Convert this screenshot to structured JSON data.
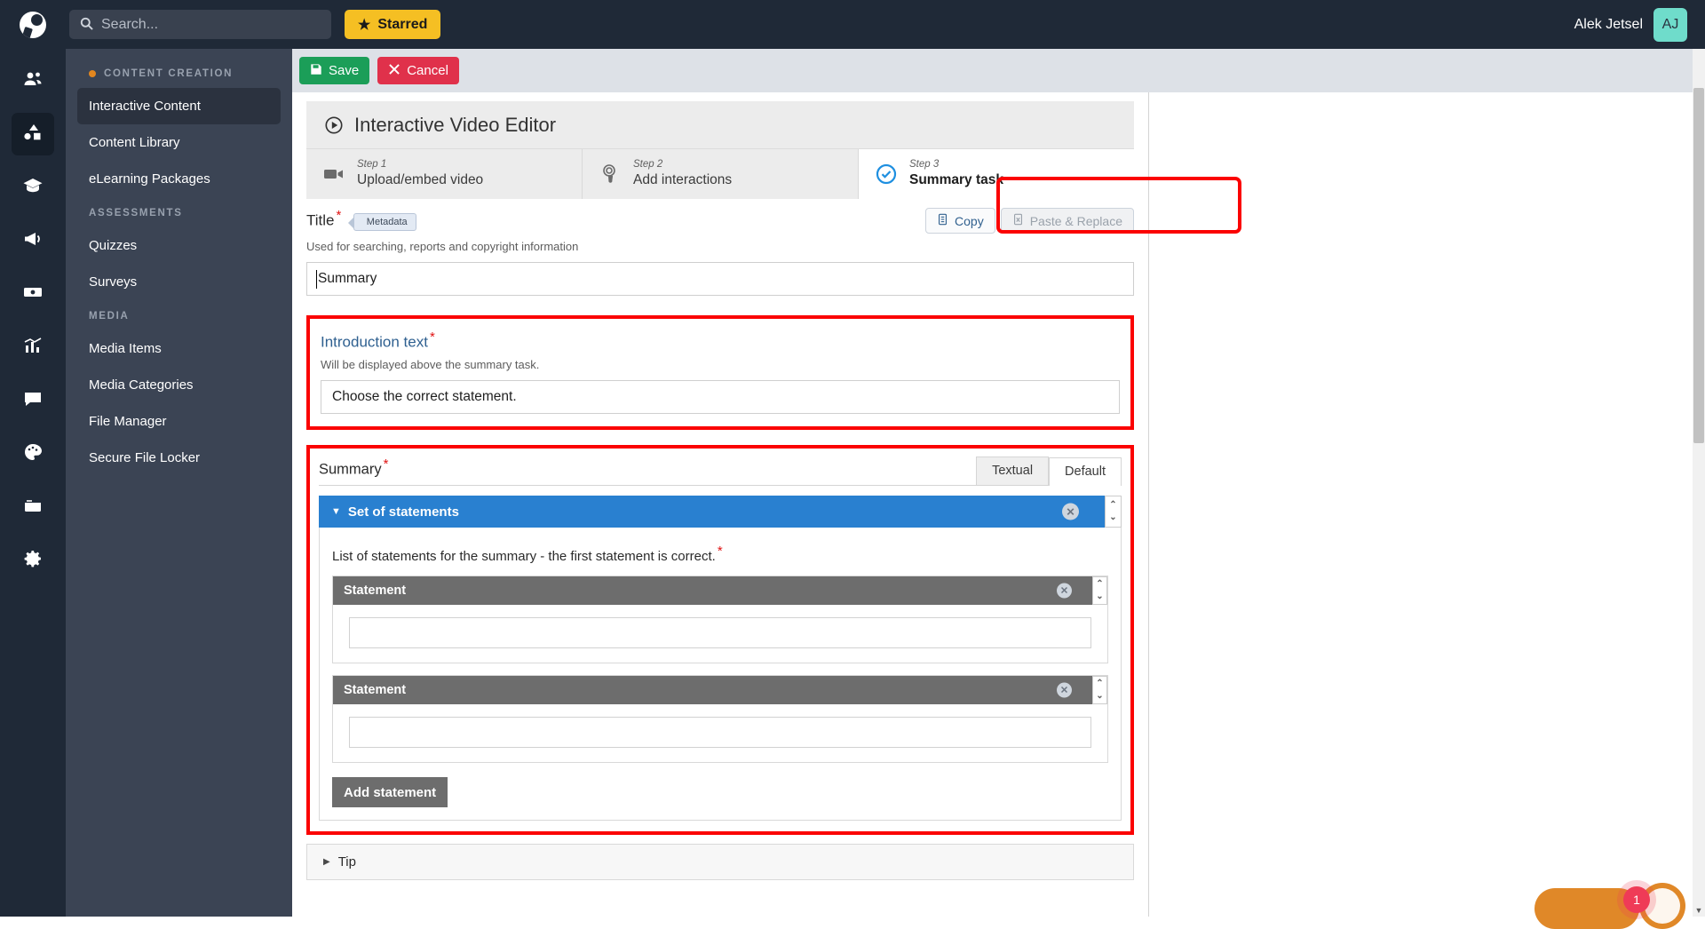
{
  "topbar": {
    "logo_icon": "app-logo-icon",
    "search": {
      "placeholder": "Search...",
      "icon": "search-icon"
    },
    "starred_label": "Starred",
    "starred_icon": "star-icon",
    "user_name": "Alek Jetsel",
    "avatar_initials": "AJ",
    "accent_yellow": "#f5bf23",
    "avatar_color": "#6fdccb"
  },
  "rail": {
    "items": [
      {
        "icon": "users-icon",
        "active": false
      },
      {
        "icon": "shapes-icon",
        "active": true
      },
      {
        "icon": "graduation-cap-icon",
        "active": false
      },
      {
        "icon": "megaphone-icon",
        "active": false
      },
      {
        "icon": "banknote-icon",
        "active": false
      },
      {
        "icon": "bar-chart-icon",
        "active": false
      },
      {
        "icon": "chat-bubble-icon",
        "active": false
      },
      {
        "icon": "palette-icon",
        "active": false
      },
      {
        "icon": "window-icon",
        "active": false
      },
      {
        "icon": "gear-icon",
        "active": false
      }
    ]
  },
  "sidebar": {
    "groups": [
      {
        "title": "CONTENT CREATION",
        "has_dot": true,
        "items": [
          {
            "label": "Interactive Content",
            "active": true
          },
          {
            "label": "Content Library",
            "active": false
          },
          {
            "label": "eLearning Packages",
            "active": false
          }
        ]
      },
      {
        "title": "ASSESSMENTS",
        "has_dot": false,
        "items": [
          {
            "label": "Quizzes",
            "active": false
          },
          {
            "label": "Surveys",
            "active": false
          }
        ]
      },
      {
        "title": "MEDIA",
        "has_dot": false,
        "items": [
          {
            "label": "Media Items",
            "active": false
          },
          {
            "label": "Media Categories",
            "active": false
          },
          {
            "label": "File Manager",
            "active": false
          },
          {
            "label": "Secure File Locker",
            "active": false
          }
        ]
      }
    ]
  },
  "toolbar": {
    "save_label": "Save",
    "save_icon": "floppy-disk-icon",
    "save_color": "#1b9e58",
    "cancel_label": "Cancel",
    "cancel_icon": "x-icon",
    "cancel_color": "#e0314b"
  },
  "editor": {
    "title": "Interactive Video Editor",
    "title_icon": "play-circle-icon",
    "steps": [
      {
        "step_label": "Step 1",
        "title": "Upload/embed video",
        "icon": "video-camera-icon",
        "active": false
      },
      {
        "step_label": "Step 2",
        "title": "Add interactions",
        "icon": "cursor-click-icon",
        "active": false
      },
      {
        "step_label": "Step 3",
        "title": "Summary task",
        "icon": "check-circle-icon",
        "active": true
      }
    ],
    "highlight_color": "#fb0202"
  },
  "title_field": {
    "label": "Title",
    "required_marker": "*",
    "metadata_tag": "Metadata",
    "help": "Used for searching, reports and copyright information",
    "value": "Summary",
    "copy_label": "Copy",
    "copy_icon": "clipboard-copy-icon",
    "paste_label": "Paste & Replace",
    "paste_icon": "clipboard-paste-icon"
  },
  "intro_field": {
    "label": "Introduction text",
    "required_marker": "*",
    "help": "Will be displayed above the summary task.",
    "value": "Choose the correct statement."
  },
  "summary_field": {
    "label": "Summary",
    "required_marker": "*",
    "tabs": [
      {
        "label": "Textual",
        "active": false
      },
      {
        "label": "Default",
        "active": true
      }
    ],
    "group": {
      "title": "Set of statements",
      "collapse_icon": "caret-down-icon",
      "remove_icon": "remove-circle-icon",
      "reorder_icon": "reorder-arrows-icon",
      "bar_color": "#2980d0",
      "list_label": "List of statements for the summary - the first statement is correct.",
      "list_required_marker": "*",
      "statements": [
        {
          "title": "Statement",
          "value": ""
        },
        {
          "title": "Statement",
          "value": ""
        }
      ],
      "add_label": "Add statement"
    }
  },
  "tip": {
    "label": "Tip",
    "expand_icon": "caret-right-icon"
  },
  "chat": {
    "badge_count": "1",
    "icon": "chat-widget-icon"
  },
  "scrollbar": {
    "up_arrow": "▲",
    "down_arrow": "▼"
  }
}
